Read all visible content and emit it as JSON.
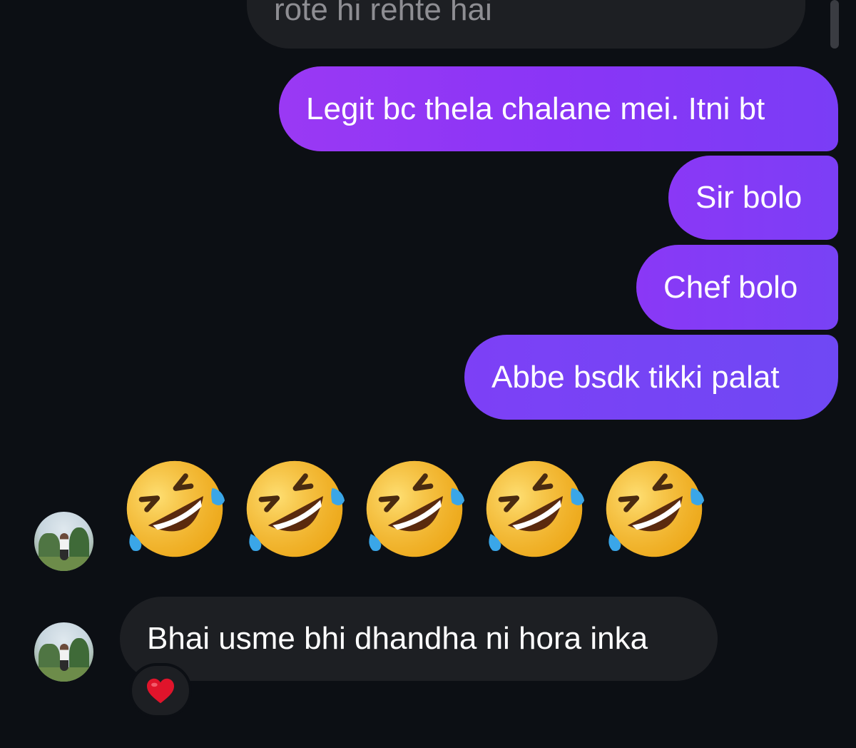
{
  "thread": {
    "previous_incoming": "rote hi rehte hai",
    "outgoing": [
      "Legit bc thela chalane mei. Itni bt",
      "Sir bolo",
      "Chef bolo",
      "Abbe bsdk tikki palat"
    ],
    "emoji_message": {
      "icons": [
        "rofl-icon",
        "rofl-icon",
        "rofl-icon",
        "rofl-icon",
        "rofl-icon"
      ]
    },
    "last_incoming": "Bhai usme bhi dhandha ni hora inka",
    "reaction_icon": "heart-icon"
  },
  "colors": {
    "background": "#0c0f14",
    "incoming_bubble": "#1d1f23",
    "outgoing_gradient_start": "#9a39f4",
    "outgoing_gradient_end": "#6f48f4",
    "muted_text": "#8e8e93",
    "reaction_heart": "#e0142b"
  }
}
